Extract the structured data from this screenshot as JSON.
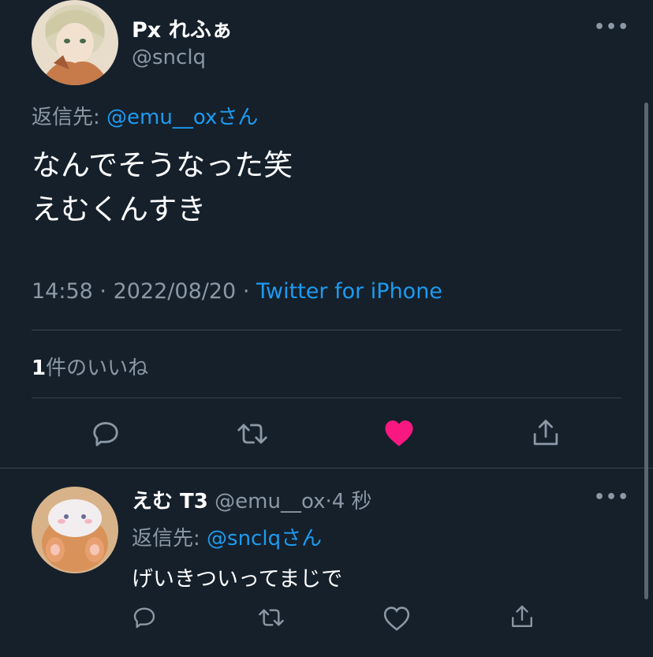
{
  "colors": {
    "background": "#15202b",
    "text": "#ffffff",
    "muted": "#8b98a5",
    "link": "#1d9bf0",
    "like_active": "#f91880",
    "divider": "#38444d"
  },
  "main_tweet": {
    "display_name": "Px れふぁ",
    "handle": "@snclq",
    "reply_to_prefix": "返信先:",
    "reply_to_handle": "@emu__ox",
    "reply_to_suffix": "さん",
    "text_line1": "なんでそうなった笑",
    "text_line2": "えむくんすき",
    "time": "14:58",
    "dot1": "·",
    "date": "2022/08/20",
    "dot2": "·",
    "source": "Twitter for iPhone",
    "likes_count": "1",
    "likes_label": "件のいいね",
    "actions": [
      "reply-icon",
      "retweet-icon",
      "like-icon-filled",
      "share-icon"
    ]
  },
  "reply_tweet": {
    "display_name": "えむ T3",
    "handle": "@emu__ox",
    "dot": "·",
    "time_ago": "4 秒",
    "reply_to_prefix": "返信先:",
    "reply_to_handle": "@snclq",
    "reply_to_suffix": "さん",
    "text": "げいきついってまじで",
    "actions": [
      "reply-icon",
      "retweet-icon",
      "like-icon",
      "share-icon"
    ]
  },
  "more_label": "•••"
}
